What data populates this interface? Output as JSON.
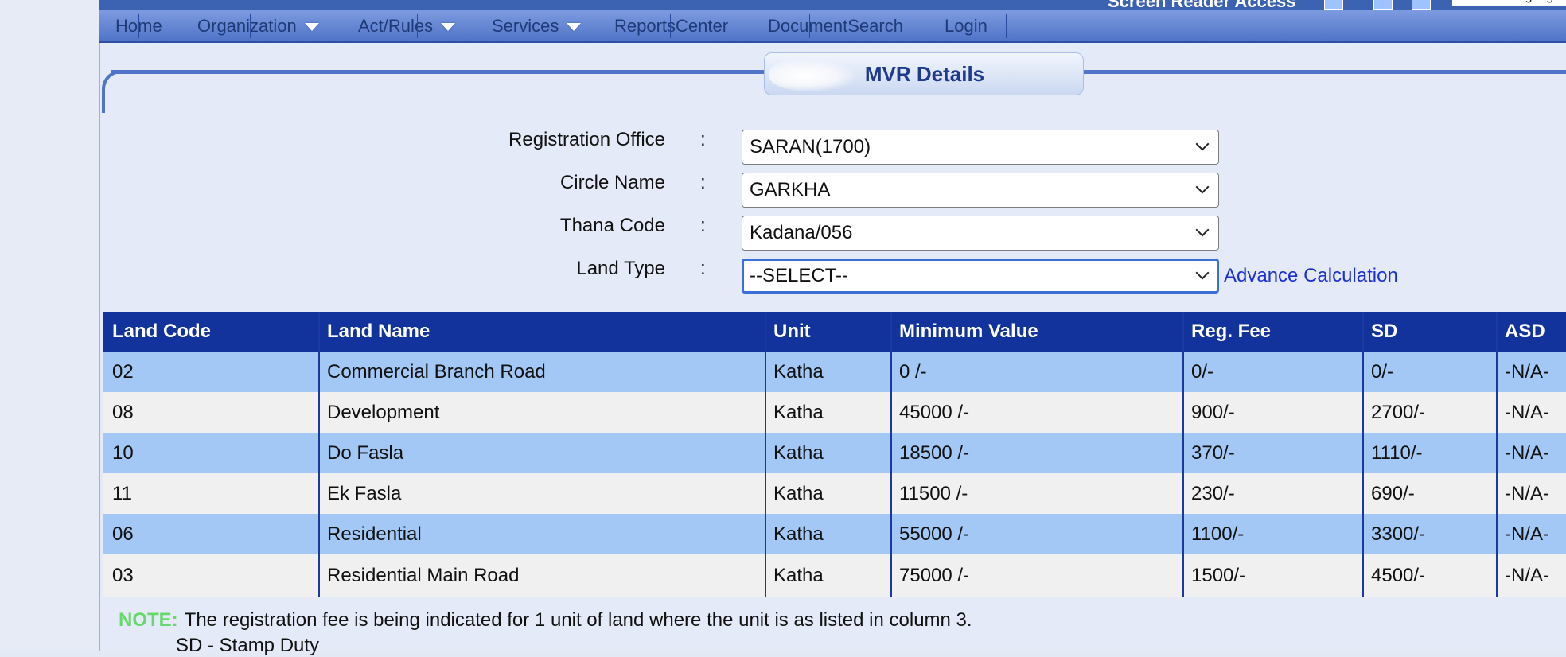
{
  "screen_reader": {
    "label": "Screen Reader Access",
    "language_placeholder": "Select a language"
  },
  "nav": {
    "items": [
      {
        "label": "Home"
      },
      {
        "label": "Organization"
      },
      {
        "label": "Act/Rules"
      },
      {
        "label": "Services"
      },
      {
        "label": "ReportsCenter"
      },
      {
        "label": "DocumentSearch"
      },
      {
        "label": "Login"
      }
    ]
  },
  "page": {
    "title": "MVR Details"
  },
  "form": {
    "registration_office": {
      "label": "Registration Office",
      "value": "SARAN(1700)"
    },
    "circle_name": {
      "label": "Circle Name",
      "value": "GARKHA"
    },
    "thana_code": {
      "label": "Thana Code",
      "value": "Kadana/056"
    },
    "land_type": {
      "label": "Land Type",
      "value": "--SELECT--"
    },
    "colon": ":",
    "advance_link": "Advance Calculation"
  },
  "table": {
    "headers": [
      "Land Code",
      "Land Name",
      "Unit",
      "Minimum Value",
      "Reg. Fee",
      "SD",
      "ASD"
    ],
    "rows": [
      [
        "02",
        "Commercial Branch Road",
        "Katha",
        "0 /-",
        "0/-",
        "0/-",
        "-N/A-"
      ],
      [
        "08",
        "Development",
        "Katha",
        "45000 /-",
        "900/-",
        "2700/-",
        "-N/A-"
      ],
      [
        "10",
        "Do Fasla",
        "Katha",
        "18500 /-",
        "370/-",
        "1110/-",
        "-N/A-"
      ],
      [
        "11",
        "Ek Fasla",
        "Katha",
        "11500 /-",
        "230/-",
        "690/-",
        "-N/A-"
      ],
      [
        "06",
        "Residential",
        "Katha",
        "55000 /-",
        "1100/-",
        "3300/-",
        "-N/A-"
      ],
      [
        "03",
        "Residential Main Road",
        "Katha",
        "75000 /-",
        "1500/-",
        "4500/-",
        "-N/A-"
      ]
    ]
  },
  "note": {
    "label": "NOTE:",
    "text": "The registration fee is being indicated for 1 unit of land where the unit is as listed in column 3.",
    "sd_legend": "SD - Stamp Duty"
  },
  "colors": {
    "nav_bar": "#4f73c7",
    "table_header": "#12339c",
    "row_alt": "#a3c8f6",
    "link": "#1a2fd6",
    "note_label": "#66d96a"
  }
}
